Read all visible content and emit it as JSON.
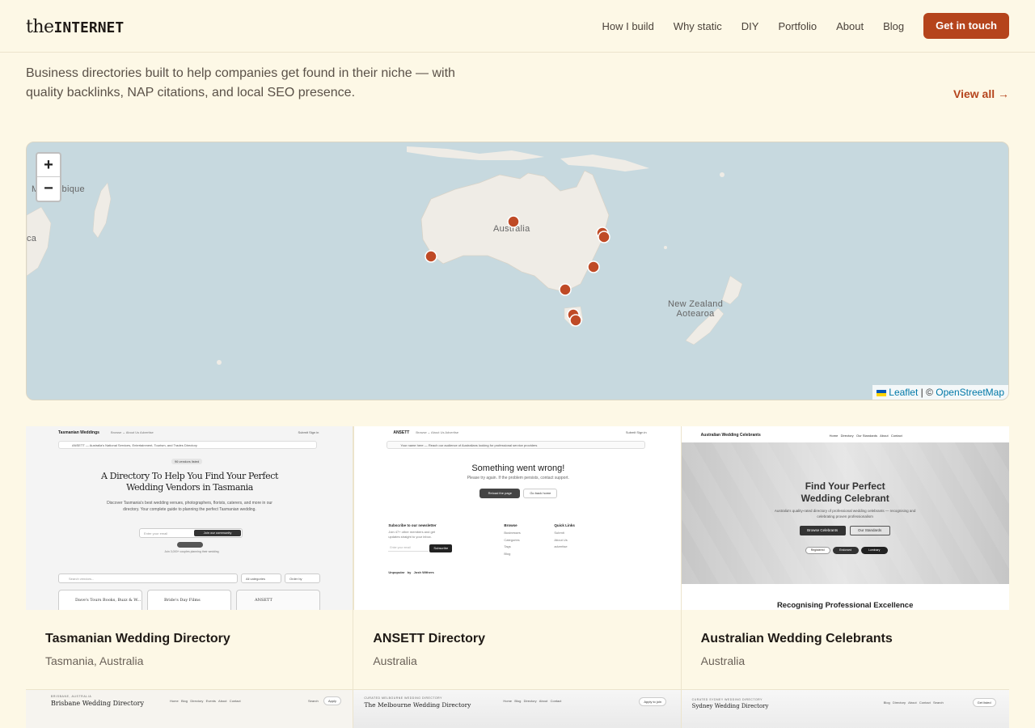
{
  "header": {
    "logo_the": "the",
    "logo_internet": "INTERNET",
    "nav": [
      "How I build",
      "Why static",
      "DIY",
      "Portfolio",
      "About",
      "Blog"
    ],
    "cta": "Get in touch"
  },
  "intro": {
    "text": "Business directories built to help companies get found in their niche — with quality backlinks, NAP citations, and local SEO presence.",
    "view_all": "View all →"
  },
  "map": {
    "zoom_in": "+",
    "zoom_out": "−",
    "labels": {
      "mozambique": "Mozambique",
      "africa_fragment": "ca",
      "australia": "Australia",
      "new_zealand_1": "New Zealand",
      "new_zealand_2": "Aotearoa"
    },
    "attribution_leaflet": "Leaflet",
    "attribution_sep": " | © ",
    "attribution_osm": "OpenStreetMap",
    "marker_color": "#bf4a26"
  },
  "cards": [
    {
      "title": "Tasmanian Wedding Directory",
      "location": "Tasmania, Australia",
      "thumb": {
        "site_name": "Tasmanian Weddings",
        "nav": "Browse ⌄   About Us   Advertise",
        "right_nav": "Submit   Sign in",
        "banner": "ANSETT — Australia's National Services, Entertainment, Tourism, and Trades Directory",
        "badge": "96 vendors listed",
        "heading": "A Directory To Help You Find Your Perfect Wedding Vendors in Tasmania",
        "sub": "Discover Tasmania's best wedding venues, photographers, florists, caterers, and more in our directory. Your complete guide to planning the perfect Tasmanian wedding.",
        "email_placeholder": "Enter your email",
        "join": "Join our community",
        "joined": "Join 3,000+ couples planning their wedding",
        "search": "Search vendors...",
        "filter": "All categories",
        "order": "Order by",
        "items": [
          "Dave's Tours Books, Buzz & W...",
          "Bride's Day Films",
          "ANSETT"
        ]
      }
    },
    {
      "title": "ANSETT Directory",
      "location": "Australia",
      "thumb": {
        "site_name": "ANSETT",
        "nav": "Browse ⌄   About Us   Advertise",
        "right_nav": "Submit   Sign in",
        "banner": "Your name here — Reach our audience of Australians looking for professional service providers",
        "banner_right": "Advertise on ANSETT",
        "error": "Something went wrong!",
        "error_sub": "Please try again. If the problem persists, contact support.",
        "reload": "Reload the page",
        "home": "Go back home",
        "newsletter": "Subscribe to our newsletter",
        "newsletter_sub": "Join 47+ other members and get updates straight to your inbox.",
        "email": "Enter your email",
        "subscribe": "Subscribe",
        "browse": "Browse",
        "browse_items": [
          "Businesses",
          "Categories",
          "Tags",
          "Blog"
        ],
        "quick": "Quick Links",
        "quick_items": [
          "Submit",
          "About Us",
          "advertise"
        ],
        "by": "Unpopular   by   Josh Withers"
      }
    },
    {
      "title": "Australian Wedding Celebrants",
      "location": "Australia",
      "thumb": {
        "site_name": "Australian Wedding Celebrants",
        "nav": "Home   Directory   Our Standards   About   Contact",
        "heading1": "Find Your Perfect",
        "heading2": "Wedding Celebrant",
        "sub": "Australia's quality-rated directory of professional wedding celebrants — recognising and celebrating proven professionalism",
        "browse": "Browse Celebrants",
        "standards": "Our Standards",
        "tags": [
          "Registered",
          "Endorsed",
          "Luminary"
        ],
        "bottom": "Recognising Professional Excellence"
      }
    }
  ],
  "cards_row2": [
    {
      "kicker": "BRISBANE, AUSTRALIA",
      "name": "Brisbane Wedding Directory",
      "nav": "Home   Blog   Directory   Events   About   Contact",
      "right": "Search",
      "btn": "Apply"
    },
    {
      "kicker": "CURATED MELBOURNE WEDDING DIRECTORY",
      "name": "The Melbourne Wedding Directory",
      "nav": "Home   Blog   Directory   About   Contact",
      "btn": "Apply to join"
    },
    {
      "kicker": "CURATED SYDNEY WEDDING DIRECTORY",
      "name": "Sydney Wedding Directory",
      "nav": "Blog   Directory   About   Contact   Search",
      "btn": "Get listed"
    }
  ]
}
